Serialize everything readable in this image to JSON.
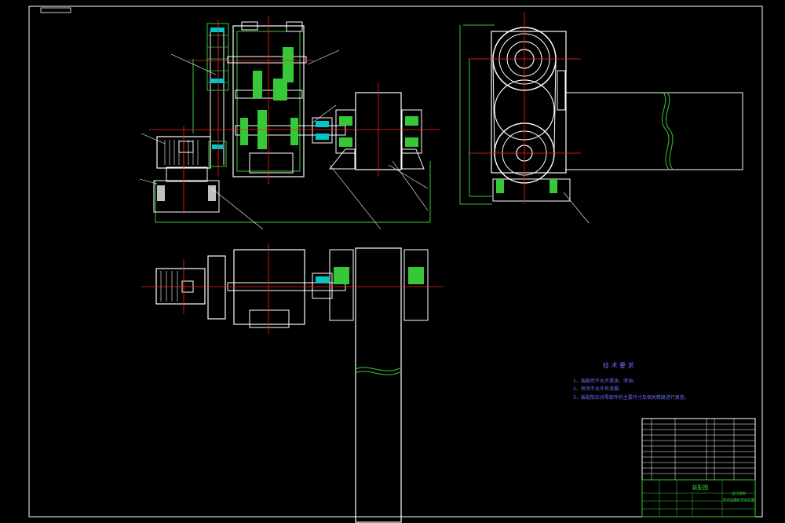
{
  "drawing": {
    "tech_requirements": {
      "title": "技 术 要 求",
      "items": [
        "1、装配后不允许漏油、渗油;",
        "2、密闭不允许有渗漏;",
        "3、装配前应对零部件的主要尺寸及相关精度进行复查。"
      ]
    },
    "title_block": {
      "drawing_name": "装配图",
      "subtitle_line1": "设计题目",
      "subtitle_line2": "带式运输机传动装置"
    },
    "colors": {
      "background": "#000000",
      "outline": "#ffffff",
      "center_line": "#ff2020",
      "part_line": "#37c837",
      "hatch": "#00c8c8",
      "note_text": "#6f6fff",
      "gear": "#ffffff"
    }
  }
}
